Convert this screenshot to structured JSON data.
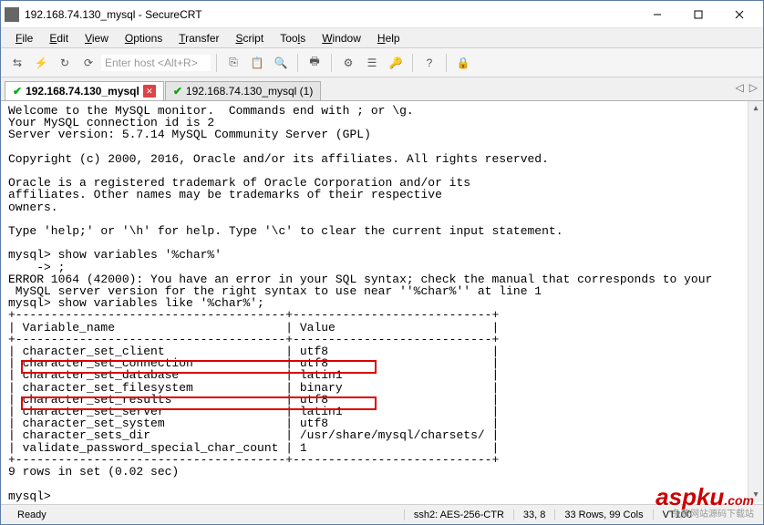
{
  "window": {
    "title": "192.168.74.130_mysql - SecureCRT"
  },
  "menu": {
    "items": [
      "File",
      "Edit",
      "View",
      "Options",
      "Transfer",
      "Script",
      "Tools",
      "Window",
      "Help"
    ]
  },
  "hostinput": {
    "placeholder": "Enter host <Alt+R>"
  },
  "tabs": {
    "items": [
      {
        "label": "192.168.74.130_mysql",
        "active": true
      },
      {
        "label": "192.168.74.130_mysql (1)",
        "active": false
      }
    ]
  },
  "terminal": {
    "lines": [
      "Welcome to the MySQL monitor.  Commands end with ; or \\g.",
      "Your MySQL connection id is 2",
      "Server version: 5.7.14 MySQL Community Server (GPL)",
      "",
      "Copyright (c) 2000, 2016, Oracle and/or its affiliates. All rights reserved.",
      "",
      "Oracle is a registered trademark of Oracle Corporation and/or its",
      "affiliates. Other names may be trademarks of their respective",
      "owners.",
      "",
      "Type 'help;' or '\\h' for help. Type '\\c' to clear the current input statement.",
      "",
      "mysql> show variables '%char%'",
      "    -> ;",
      "ERROR 1064 (42000): You have an error in your SQL syntax; check the manual that corresponds to your",
      " MySQL server version for the right syntax to use near ''%char%'' at line 1",
      "mysql> show variables like '%char%';",
      "+--------------------------------------+----------------------------+",
      "| Variable_name                        | Value                      |",
      "+--------------------------------------+----------------------------+",
      "| character_set_client                 | utf8                       |",
      "| character_set_connection             | utf8                       |",
      "| character_set_database               | latin1                     |",
      "| character_set_filesystem             | binary                     |",
      "| character_set_results                | utf8                       |",
      "| character_set_server                 | latin1                     |",
      "| character_set_system                 | utf8                       |",
      "| character_sets_dir                   | /usr/share/mysql/charsets/ |",
      "| validate_password_special_char_count | 1                          |",
      "+--------------------------------------+----------------------------+",
      "9 rows in set (0.02 sec)",
      "",
      "mysql>"
    ]
  },
  "status": {
    "ready": "Ready",
    "conn": "ssh2: AES-256-CTR",
    "pos": "33,   8",
    "size": "33 Rows, 99 Cols",
    "term": "VT100"
  },
  "watermark": {
    "text": "aspku",
    "suffix": ".com",
    "sub": "免费网站源码下载站"
  }
}
